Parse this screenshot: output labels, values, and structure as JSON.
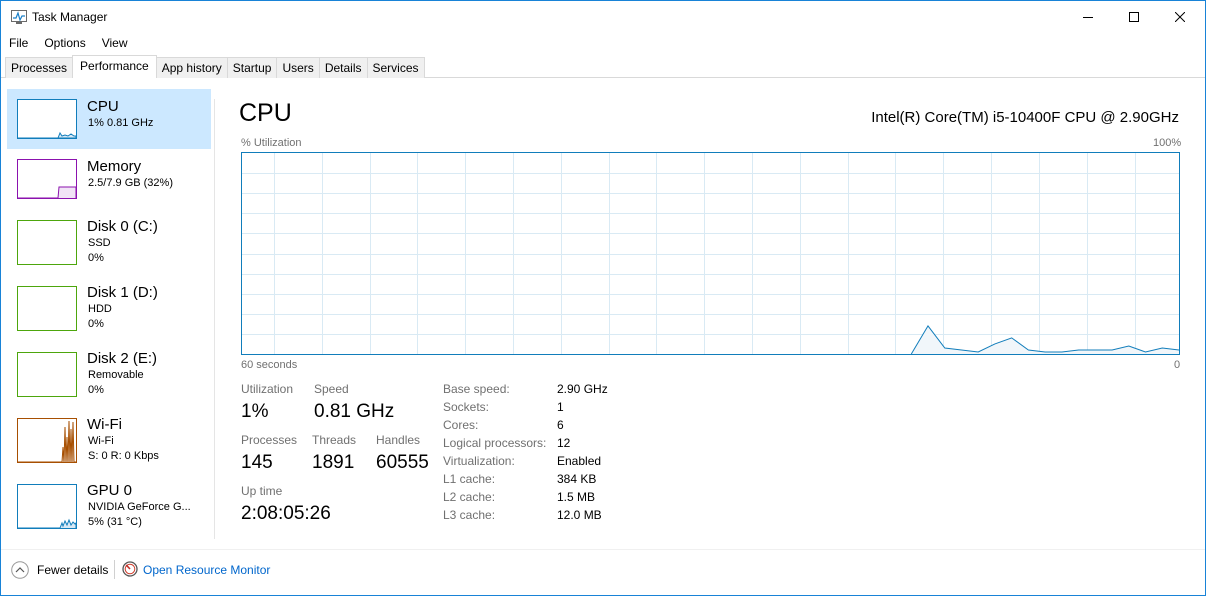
{
  "window": {
    "title": "Task Manager"
  },
  "menu": [
    "File",
    "Options",
    "View"
  ],
  "tabs": [
    "Processes",
    "Performance",
    "App history",
    "Startup",
    "Users",
    "Details",
    "Services"
  ],
  "sidebar": {
    "items": [
      {
        "name": "CPU",
        "sub1": "1% 0.81 GHz",
        "color": "#117dbb"
      },
      {
        "name": "Memory",
        "sub1": "2.5/7.9 GB (32%)",
        "color": "#8b12ae"
      },
      {
        "name": "Disk 0 (C:)",
        "sub1": "SSD",
        "sub2": "0%",
        "color": "#4da60c"
      },
      {
        "name": "Disk 1 (D:)",
        "sub1": "HDD",
        "sub2": "0%",
        "color": "#4da60c"
      },
      {
        "name": "Disk 2 (E:)",
        "sub1": "Removable",
        "sub2": "0%",
        "color": "#4da60c"
      },
      {
        "name": "Wi-Fi",
        "sub1": "Wi-Fi",
        "sub2": "S: 0 R: 0 Kbps",
        "color": "#a74f01"
      },
      {
        "name": "GPU 0",
        "sub1": "NVIDIA GeForce G...",
        "sub2": "5% (31 °C)",
        "color": "#117dbb"
      }
    ]
  },
  "main": {
    "title": "CPU",
    "model": "Intel(R) Core(TM) i5-10400F CPU @ 2.90GHz",
    "graph": {
      "y_label": "% Utilization",
      "y_max_label": "100%",
      "x_label": "60 seconds",
      "x_min_label": "0",
      "utilization_history": [
        0,
        0,
        0,
        0,
        0,
        0,
        0,
        0,
        0,
        0,
        0,
        0,
        0,
        0,
        0,
        0,
        0,
        0,
        0,
        0,
        0,
        0,
        0,
        0,
        0,
        0,
        0,
        0,
        0,
        0,
        0,
        0,
        0,
        0,
        0,
        0,
        0,
        0,
        0,
        0,
        0,
        14,
        3,
        2,
        1,
        5,
        8,
        2,
        1,
        1,
        2,
        2,
        2,
        4,
        1,
        3,
        2
      ]
    },
    "stats": {
      "utilization_label": "Utilization",
      "utilization": "1%",
      "speed_label": "Speed",
      "speed": "0.81 GHz",
      "processes_label": "Processes",
      "processes": "145",
      "threads_label": "Threads",
      "threads": "1891",
      "handles_label": "Handles",
      "handles": "60555",
      "uptime_label": "Up time",
      "uptime": "2:08:05:26"
    },
    "specs": [
      {
        "label": "Base speed:",
        "value": "2.90 GHz"
      },
      {
        "label": "Sockets:",
        "value": "1"
      },
      {
        "label": "Cores:",
        "value": "6"
      },
      {
        "label": "Logical processors:",
        "value": "12"
      },
      {
        "label": "Virtualization:",
        "value": "Enabled"
      },
      {
        "label": "L1 cache:",
        "value": "384 KB"
      },
      {
        "label": "L2 cache:",
        "value": "1.5 MB"
      },
      {
        "label": "L3 cache:",
        "value": "12.0 MB"
      }
    ]
  },
  "footer": {
    "fewer_details": "Fewer details",
    "open_monitor": "Open Resource Monitor"
  },
  "colors": {
    "accent": "#117dbb",
    "selection": "#cce8ff",
    "link": "#0066cc"
  }
}
